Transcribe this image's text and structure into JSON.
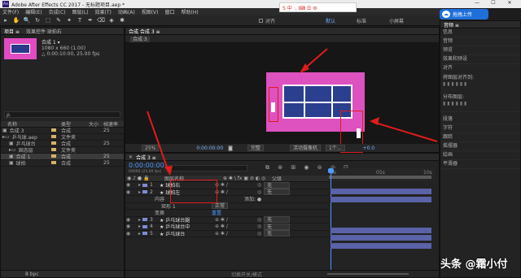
{
  "window": {
    "title": "Adobe After Effects CC 2017 - 无标题项目.aep *",
    "controls": [
      "—",
      "☐",
      "✕"
    ]
  },
  "menu": [
    "文件(F)",
    "编辑(E)",
    "合成(C)",
    "图层(L)",
    "效果(T)",
    "动画(A)",
    "视图(V)",
    "窗口",
    "帮助(H)"
  ],
  "toolbar": {
    "tools": [
      "▸",
      "✋",
      "🔍",
      "↻",
      "⬚",
      "✎",
      "✦",
      "T",
      "✒",
      "⌫",
      "◈",
      "✱"
    ],
    "align_label": "对齐",
    "workspaces": [
      "默认",
      "标准",
      "小屏幕"
    ],
    "search_placeholder": "搜索帮助"
  },
  "overlay": {
    "ime": "S 中 ·, ⌨ ☰ ⚙",
    "upload_btn": "拖拽上传"
  },
  "project": {
    "tabs": [
      "项目 ≡",
      "效果控件 球拍右"
    ],
    "comp_name": "合成 1 ▾",
    "comp_info1": "1080 x 660 (1.00)",
    "comp_info2": "△ 0:00:10:00, 25.00 fps",
    "search_placeholder": "ρ.",
    "headers": [
      "名称",
      "",
      "类型",
      "大小",
      "帧速率"
    ],
    "items": [
      {
        "indent": 0,
        "name": "合成 3",
        "color": "#d4b26a",
        "type": "合成",
        "fps": "25"
      },
      {
        "indent": 0,
        "name": "乒乓球.aep",
        "color": "#d4b26a",
        "type": "文件夹",
        "fps": ""
      },
      {
        "indent": 1,
        "name": "乒乓球台",
        "color": "#d4b26a",
        "type": "合成",
        "fps": "25"
      },
      {
        "indent": 1,
        "name": "固态层",
        "color": "#d4b26a",
        "type": "文件夹",
        "fps": ""
      },
      {
        "indent": 1,
        "name": "合成 1",
        "color": "#d4b26a",
        "type": "合成",
        "fps": "25"
      },
      {
        "indent": 1,
        "name": "球拍",
        "color": "#d4b26a",
        "type": "合成",
        "fps": "25"
      }
    ],
    "footer": "8 bpc"
  },
  "composition": {
    "tab": "合成 合成 3 ≡",
    "breadcrumb": "合成 3",
    "zoom": "25%",
    "timecode": "0:00:00:00",
    "quality": "完整",
    "camera": "活动摄像机",
    "views": "1个...",
    "exposure": "+0.0"
  },
  "timeline": {
    "tab": "合成 3 ≡",
    "time": "0:00:00:00",
    "frames": "00000 (25.00 fps)",
    "col_name": "图层名称",
    "col_parent": "父级",
    "layers": [
      {
        "num": "1",
        "name": "★ 球拍右",
        "color": "#7d8dd4",
        "parent": "无"
      },
      {
        "num": "2",
        "name": "★ 球拍左",
        "color": "#7d8dd4",
        "parent": "无"
      }
    ],
    "sub": {
      "content": "内容",
      "add": "添加: ●",
      "rect": "矩形 1",
      "mode": "正常",
      "transform": "变换",
      "reset": "重置"
    },
    "layers2": [
      {
        "num": "3",
        "name": "★ 乒乓球台腿",
        "color": "#7d8dd4",
        "parent": "无"
      },
      {
        "num": "4",
        "name": "★ 乒乓球台中",
        "color": "#7d8dd4",
        "parent": "无"
      },
      {
        "num": "5",
        "name": "★ 乒乓球台",
        "color": "#7d8dd4",
        "parent": "无"
      }
    ],
    "ruler": [
      "0s",
      "05s",
      "10s"
    ],
    "footer": "切换开关/模式"
  },
  "right_panel": {
    "title": "音频 ≡",
    "items": [
      "信息",
      "音频",
      "预览",
      "效果和预设",
      "对齐",
      "段落",
      "字符",
      "跟踪",
      "摇摆器",
      "绘画",
      "平滑器"
    ],
    "align_to": "将图层对齐到:",
    "distribute": "分布图层:"
  },
  "watermark": "头条 @霜小付"
}
